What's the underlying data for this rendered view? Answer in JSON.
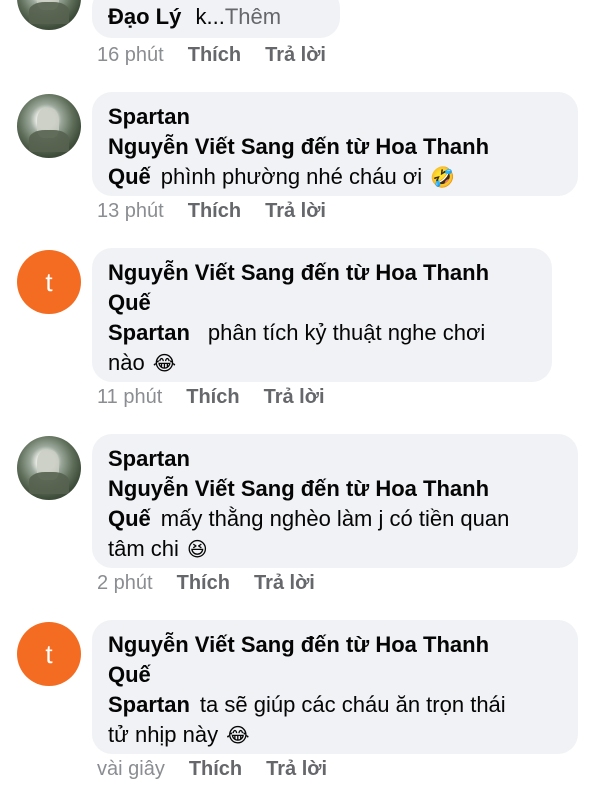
{
  "comments": [
    {
      "line1_name": "Đạo Lý",
      "line1_text": "k...",
      "more": "Thêm",
      "time": "16 phút",
      "like": "Thích",
      "reply": "Trả lời"
    },
    {
      "author": "Spartan",
      "mention": "Nguyễn Viết Sang đến từ Hoa Thanh",
      "mention_end": "Quế",
      "text": "phình phường nhé cháu ơi",
      "emoji": "🤣",
      "time": "13 phút",
      "like": "Thích",
      "reply": "Trả lời"
    },
    {
      "avatar_letter": "t",
      "mention": "Nguyễn Viết Sang đến từ Hoa Thanh",
      "mention_end": "Quế",
      "inline_name": "Spartan",
      "text1": "phân tích kỷ thuật nghe chơi",
      "text2": "nào",
      "emoji": "😂",
      "time": "11 phút",
      "like": "Thích",
      "reply": "Trả lời"
    },
    {
      "author": "Spartan",
      "mention": "Nguyễn Viết Sang đến từ Hoa Thanh",
      "mention_end": "Quế",
      "text1": "mấy thằng nghèo làm j có tiền quan",
      "text2": "tâm chi",
      "emoji": "😆",
      "time": "2 phút",
      "like": "Thích",
      "reply": "Trả lời"
    },
    {
      "avatar_letter": "t",
      "mention": "Nguyễn Viết Sang đến từ Hoa Thanh",
      "mention_end": "Quế",
      "inline_name": "Spartan",
      "text1": "ta sẽ giúp các cháu ăn trọn thái",
      "text2": "tử nhịp này",
      "emoji": "😂",
      "time": "vài giây",
      "like": "Thích",
      "reply": "Trả lời"
    }
  ],
  "colors": {
    "bubble": "#f0f2f5",
    "letter_avatar": "#f36c21",
    "meta_text": "#8a8d91"
  }
}
